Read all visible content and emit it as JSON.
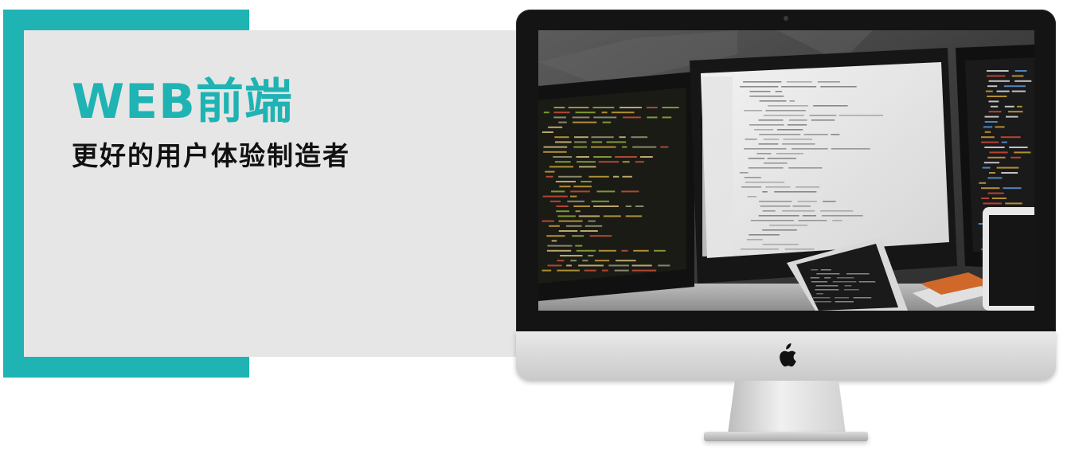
{
  "hero": {
    "title": "WEB前端",
    "subtitle": "更好的用户体验制造者"
  },
  "colors": {
    "accent": "#1fb3b3",
    "panel_background": "#e6e6e6",
    "subtitle_text": "#111111"
  },
  "illustration": {
    "device": "imac-desktop",
    "screen_content": "developer-workspace-photo",
    "logo_icon": "apple-logo-icon"
  }
}
